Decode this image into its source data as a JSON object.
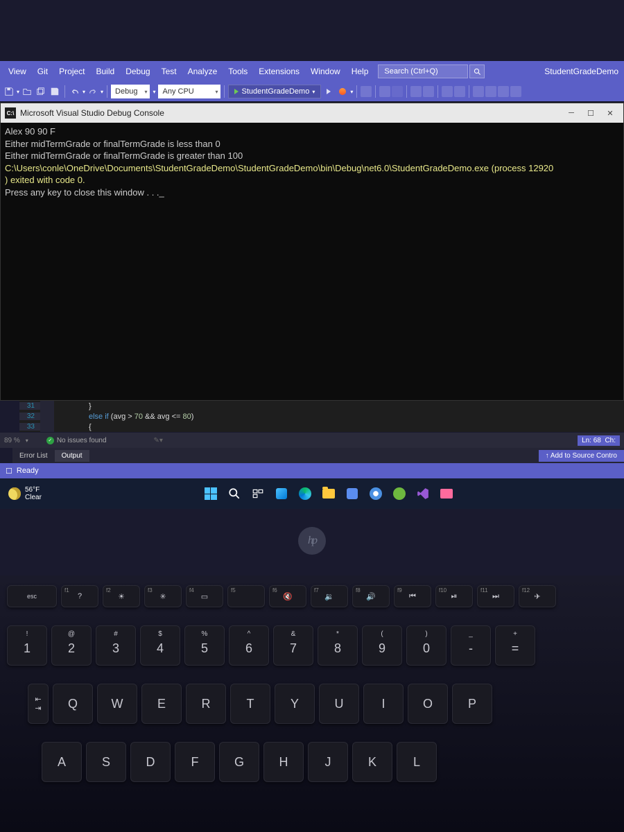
{
  "menu": {
    "items": [
      "View",
      "Git",
      "Project",
      "Build",
      "Debug",
      "Test",
      "Analyze",
      "Tools",
      "Extensions",
      "Window",
      "Help"
    ],
    "search_placeholder": "Search (Ctrl+Q)",
    "app_name": "StudentGradeDemo"
  },
  "toolbar": {
    "config": "Debug",
    "platform": "Any CPU",
    "run_target": "StudentGradeDemo"
  },
  "console": {
    "title": "Microsoft Visual Studio Debug Console",
    "title_badge": "C:\\",
    "lines": [
      "Alex 90 90 F",
      "Either midTermGrade or finalTermGrade is less than 0",
      "Either midTermGrade or finalTermGrade is greater than 100",
      "",
      "C:\\Users\\conle\\OneDrive\\Documents\\StudentGradeDemo\\StudentGradeDemo\\bin\\Debug\\net6.0\\StudentGradeDemo.exe (process 12920",
      ") exited with code 0.",
      "Press any key to close this window . . ._"
    ]
  },
  "editor": {
    "lines": [
      {
        "num": "31",
        "text": "            }"
      },
      {
        "num": "32",
        "text": "            else if (avg > 70 && avg <= 80)"
      },
      {
        "num": "33",
        "text": "            {"
      }
    ]
  },
  "status": {
    "percent": "89 %",
    "issues": "No issues found",
    "line_info_ln": "Ln: 68",
    "line_info_ch": "Ch:"
  },
  "tabs": {
    "error_list": "Error List",
    "output": "Output",
    "add_source": "↑ Add to Source Contro"
  },
  "vs_bottom": {
    "ready": "Ready"
  },
  "taskbar": {
    "temp": "56°F",
    "weather": "Clear"
  },
  "hp": "hp",
  "keyboard": {
    "fn_row": [
      {
        "l": "esc",
        "i": ""
      },
      {
        "l": "f1",
        "i": "?"
      },
      {
        "l": "f2",
        "i": "☀"
      },
      {
        "l": "f3",
        "i": "✳"
      },
      {
        "l": "f4",
        "i": "▭"
      },
      {
        "l": "f5",
        "i": ""
      },
      {
        "l": "f6",
        "i": "🔇"
      },
      {
        "l": "f7",
        "i": "🔉"
      },
      {
        "l": "f8",
        "i": "🔊"
      },
      {
        "l": "f9",
        "i": "⏮"
      },
      {
        "l": "f10",
        "i": "⏯"
      },
      {
        "l": "f11",
        "i": "⏭"
      },
      {
        "l": "f12",
        "i": "✈"
      }
    ],
    "num_row": [
      {
        "u": "!",
        "m": "1"
      },
      {
        "u": "@",
        "m": "2"
      },
      {
        "u": "#",
        "m": "3"
      },
      {
        "u": "$",
        "m": "4"
      },
      {
        "u": "%",
        "m": "5"
      },
      {
        "u": "^",
        "m": "6"
      },
      {
        "u": "&",
        "m": "7"
      },
      {
        "u": "*",
        "m": "8"
      },
      {
        "u": "(",
        "m": "9"
      },
      {
        "u": ")",
        "m": "0"
      },
      {
        "u": "_",
        "m": "-"
      },
      {
        "u": "+",
        "m": "="
      }
    ],
    "row_q": [
      "Q",
      "W",
      "E",
      "R",
      "T",
      "Y",
      "U",
      "I",
      "O",
      "P"
    ],
    "row_a": [
      "A",
      "S",
      "D",
      "F",
      "G",
      "H",
      "J",
      "K",
      "L"
    ]
  }
}
